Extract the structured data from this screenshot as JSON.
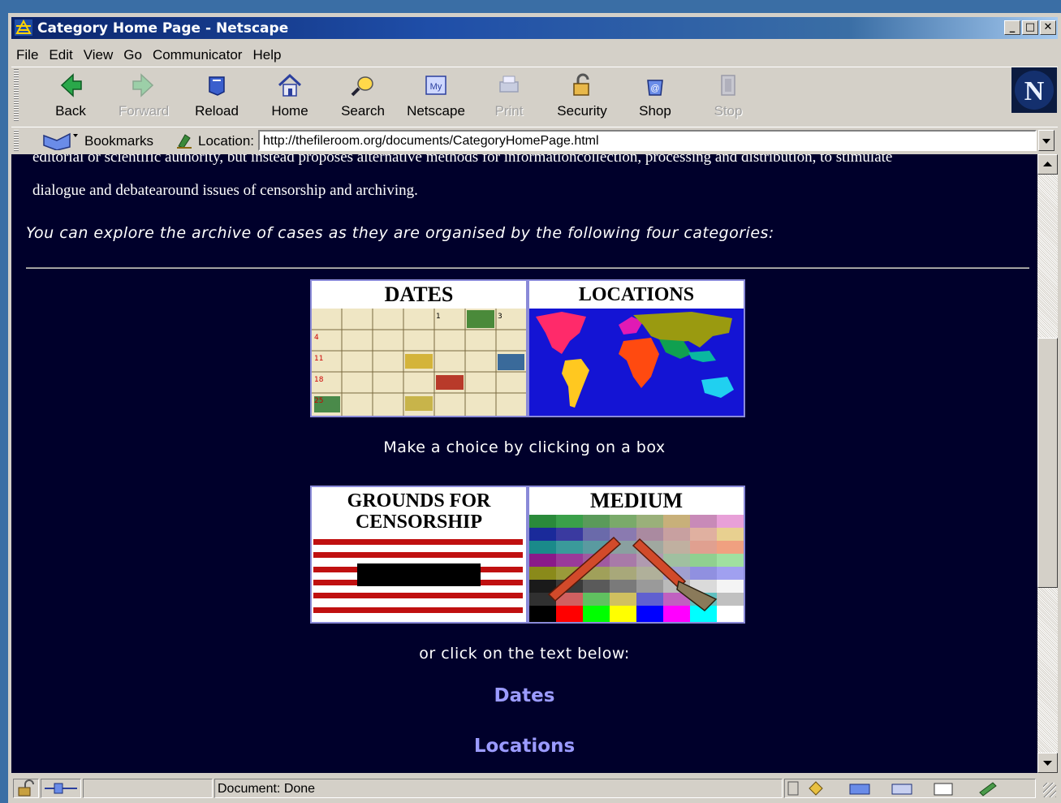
{
  "window": {
    "title": "Category Home Page - Netscape"
  },
  "menu": [
    "File",
    "Edit",
    "View",
    "Go",
    "Communicator",
    "Help"
  ],
  "toolbar": [
    {
      "label": "Back",
      "icon": "back-icon",
      "enabled": true
    },
    {
      "label": "Forward",
      "icon": "forward-icon",
      "enabled": false
    },
    {
      "label": "Reload",
      "icon": "reload-icon",
      "enabled": true
    },
    {
      "label": "Home",
      "icon": "home-icon",
      "enabled": true
    },
    {
      "label": "Search",
      "icon": "search-icon",
      "enabled": true
    },
    {
      "label": "Netscape",
      "icon": "netscape-icon",
      "enabled": true
    },
    {
      "label": "Print",
      "icon": "print-icon",
      "enabled": false
    },
    {
      "label": "Security",
      "icon": "security-icon",
      "enabled": true
    },
    {
      "label": "Shop",
      "icon": "shop-icon",
      "enabled": true
    },
    {
      "label": "Stop",
      "icon": "stop-icon",
      "enabled": false
    }
  ],
  "location": {
    "bookmarks_label": "Bookmarks",
    "location_label": "Location:",
    "url": "http://thefileroom.org/documents/CategoryHomePage.html"
  },
  "content": {
    "cut_line": "editorial or scientific authority, but instead proposes alternative methods for informationcollection, processing and distribution, to stimulate",
    "intro_line": "dialogue and debatearound issues of censorship and archiving.",
    "italic_line": "You can explore the archive of cases as they are organised by the following four categories:",
    "boxes": {
      "dates": "DATES",
      "locations": "LOCATIONS",
      "grounds_line1": "GROUNDS FOR",
      "grounds_line2": "CENSORSHIP",
      "medium": "MEDIUM"
    },
    "choice_text": "Make a choice by clicking on a box",
    "or_text": "or click on the text below:",
    "links": [
      "Dates",
      "Locations"
    ]
  },
  "status": {
    "text": "Document: Done"
  },
  "colors": {
    "page_background": "#00002b",
    "link": "#9b9bff",
    "title_bar": "#0a246a"
  }
}
